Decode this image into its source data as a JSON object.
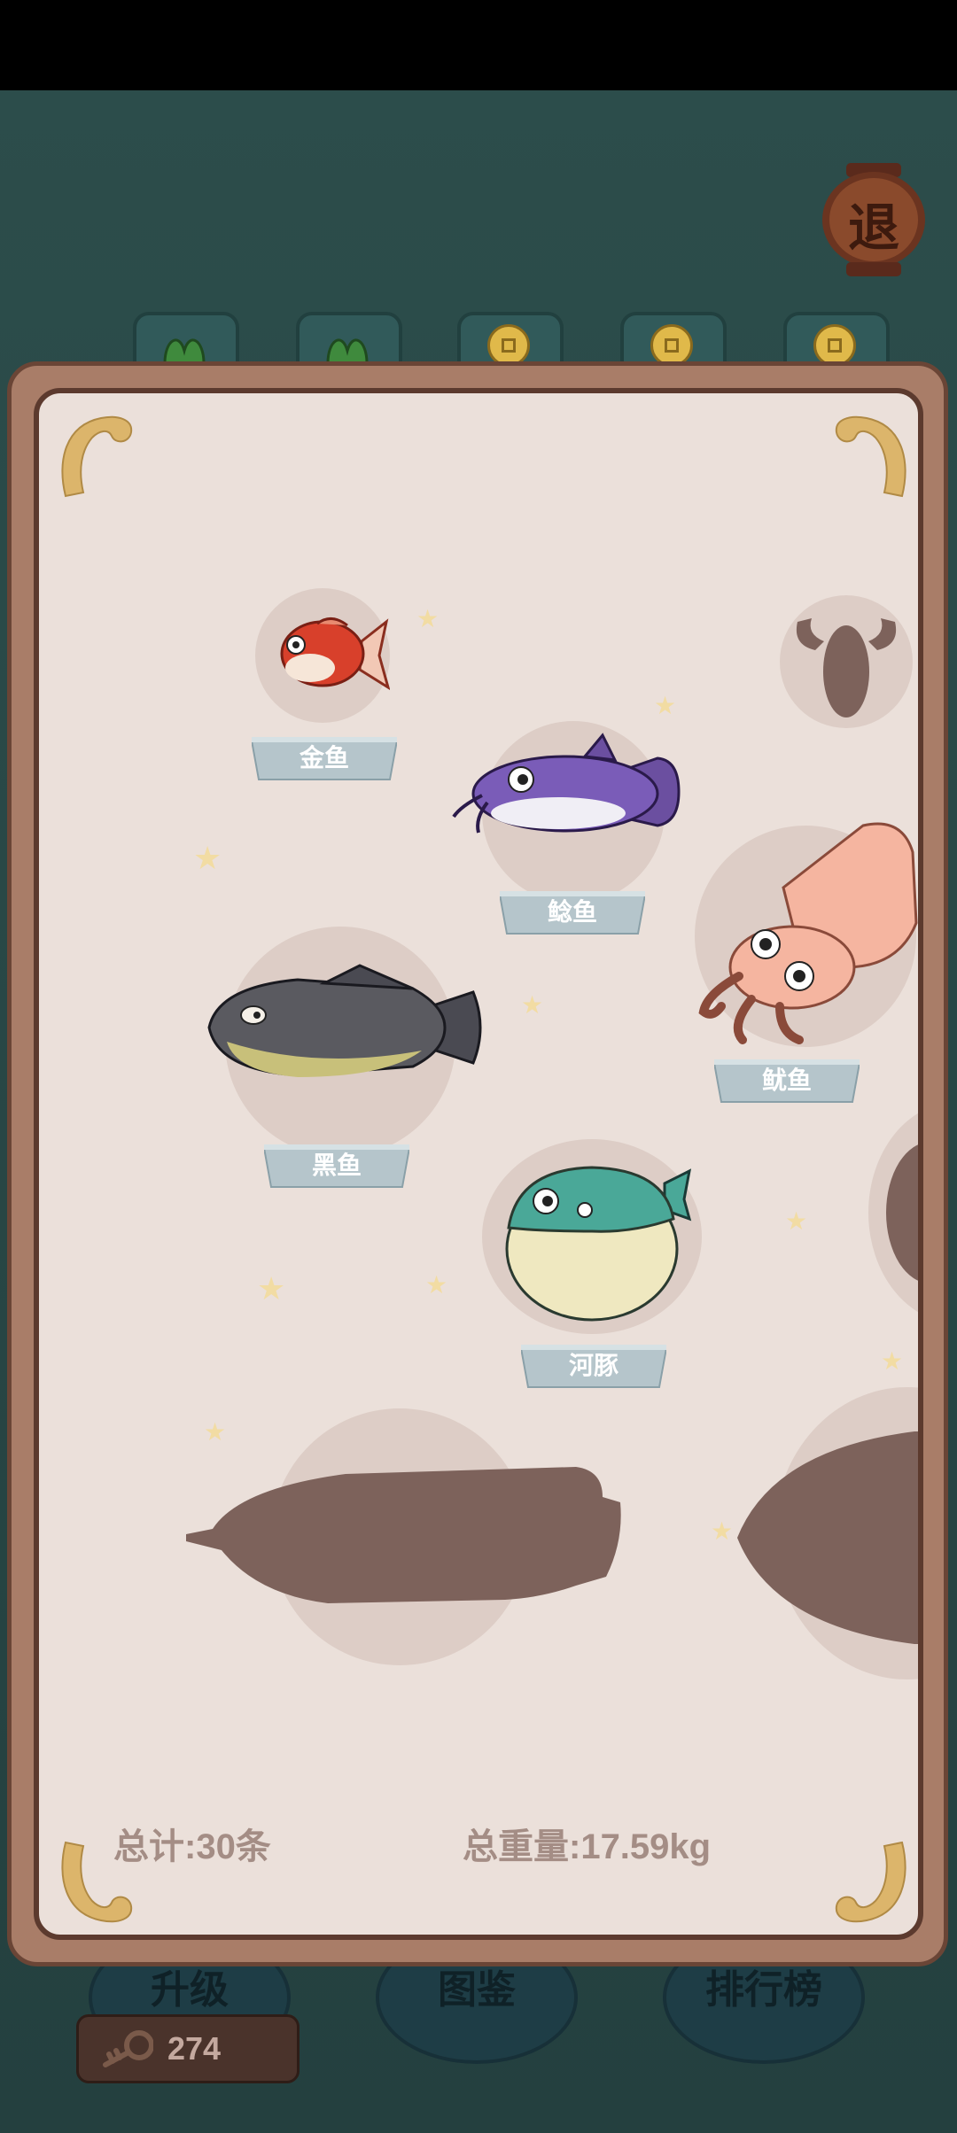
{
  "exit_button": {
    "label": "退"
  },
  "tabs": [
    {
      "icon": "green-leaf-icon"
    },
    {
      "icon": "green-leaf-icon"
    },
    {
      "icon": "coin-icon"
    },
    {
      "icon": "coin-icon"
    },
    {
      "icon": "coin-icon"
    }
  ],
  "collection": {
    "fish": [
      {
        "name": "金鱼",
        "discovered": true
      },
      {
        "name": "鲶鱼",
        "discovered": true
      },
      {
        "name": "鱿鱼",
        "discovered": true
      },
      {
        "name": "黑鱼",
        "discovered": true
      },
      {
        "name": "河豚",
        "discovered": true
      },
      {
        "name": "",
        "discovered": false
      },
      {
        "name": "",
        "discovered": false
      },
      {
        "name": "",
        "discovered": false
      },
      {
        "name": "",
        "discovered": false
      }
    ],
    "total_count": "总计:30条",
    "total_weight": "总重量:17.59kg"
  },
  "bottom_menu": {
    "upgrade": "升级",
    "atlas": "图鉴",
    "leaderboard": "排行榜"
  },
  "keys": {
    "count": "274",
    "icon": "key-icon"
  },
  "colors": {
    "panel_bg": "#ebe0da",
    "frame": "#a97d68",
    "name_tag": "#b5c5cb",
    "silhouette": "#7d625b"
  }
}
